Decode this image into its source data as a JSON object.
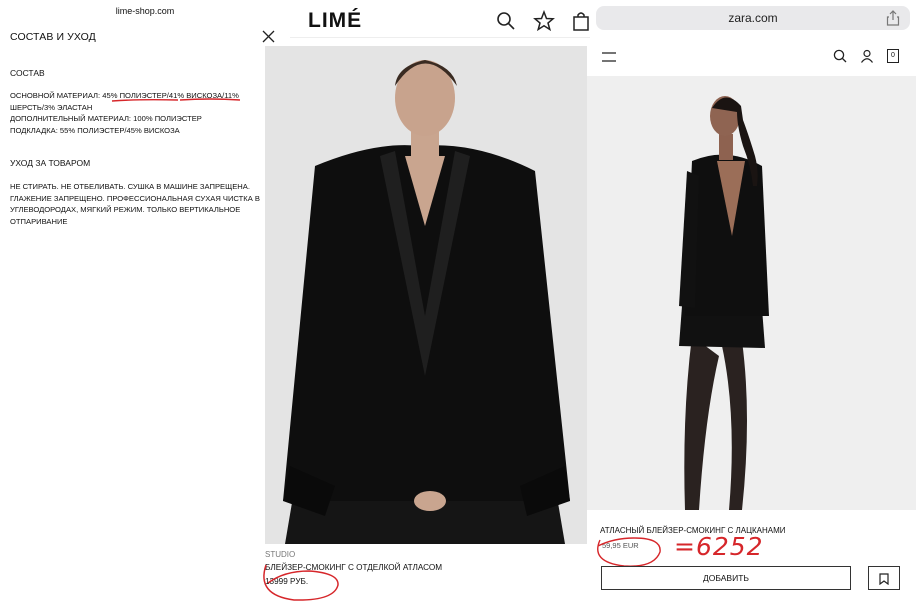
{
  "lime_panel": {
    "url": "lime-shop.com",
    "title": "СОСТАВ И УХОД",
    "composition_heading": "СОСТАВ",
    "main_material_prefix": "ОСНОВНОЙ МАТЕРИАЛ: ",
    "main_polyester": "45% ПОЛИЭСТЕР",
    "main_viscose": "41% ВИСКОЗА",
    "main_rest_1": "/11%",
    "main_rest_2": "ШЕРСТЬ/3% ЭЛАСТАН",
    "extra_material": "ДОПОЛНИТЕЛЬНЫЙ МАТЕРИАЛ: 100% ПОЛИЭСТЕР",
    "lining": "ПОДКЛАДКА: 55% ПОЛИЭСТЕР/45% ВИСКОЗА",
    "care_heading": "УХОД ЗА ТОВАРОМ",
    "care_line_1": "НЕ СТИРАТЬ. НЕ ОТБЕЛИВАТЬ. СУШКА В МАШИНЕ ЗАПРЕЩЕНА.",
    "care_line_2": "ГЛАЖЕНИЕ ЗАПРЕЩЕНО. ПРОФЕССИОНАЛЬНАЯ СУХАЯ ЧИСТКА В",
    "care_line_3": "УГЛЕВОДОРОДАХ, МЯГКИЙ РЕЖИМ. ТОЛЬКО ВЕРТИКАЛЬНОЕ",
    "care_line_4": "ОТПАРИВАНИЕ"
  },
  "lime_product": {
    "logo": "LIMÉ",
    "collection": "STUDIO",
    "name": "БЛЕЙЗЕР-СМОКИНГ С ОТДЕЛКОЙ АТЛАСОМ",
    "price": "13999 РУБ."
  },
  "zara": {
    "url": "zara.com",
    "name": "АТЛАСНЫЙ БЛЕЙЗЕР-СМОКИНГ С ЛАЦКАНАМИ",
    "price": "59,95 EUR",
    "handwritten_note": "=6252",
    "add_button": "ДОБАВИТЬ",
    "bag_count": "0"
  },
  "colors": {
    "annotation_red": "#d6262a",
    "lime_photo_bg": "#e6e6e6",
    "zara_photo_bg": "#efefef"
  }
}
